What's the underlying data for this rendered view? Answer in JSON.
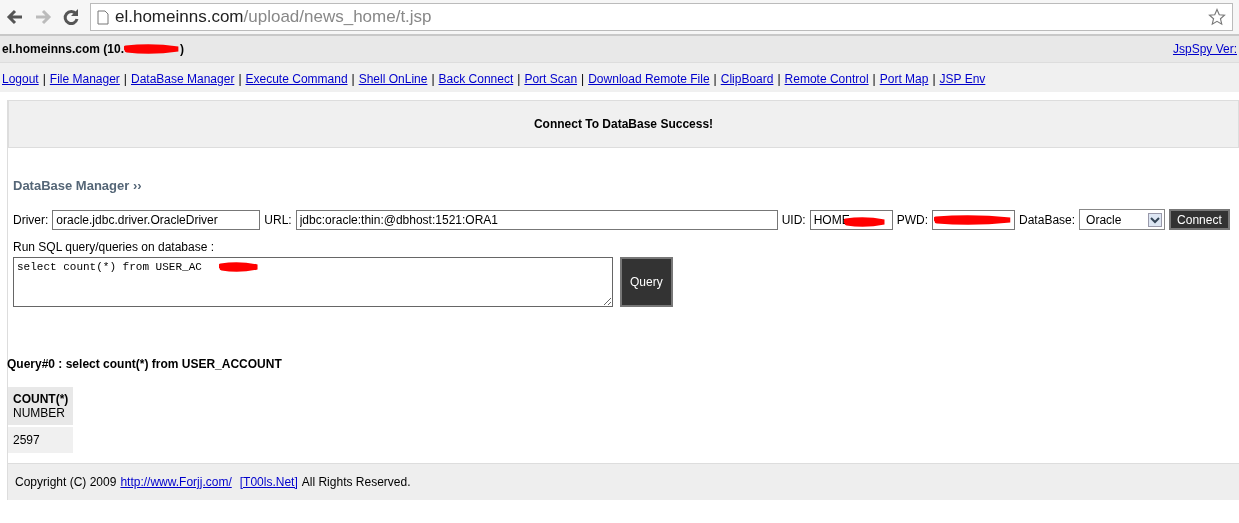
{
  "browser": {
    "url_host": "el.homeinns.com",
    "url_path": "/upload/news_home/t.jsp"
  },
  "header": {
    "host_prefix": "el.homeinns.com (10.",
    "host_suffix": ")",
    "redacted": true,
    "version_link": "JspSpy Ver:"
  },
  "nav": [
    "Logout",
    "File Manager",
    "DataBase Manager",
    "Execute Command",
    "Shell OnLine",
    "Back Connect",
    "Port Scan",
    "Download Remote File",
    "ClipBoard",
    "Remote Control",
    "Port Map",
    "JSP Env"
  ],
  "nav_separator": "|",
  "message": "Connect To DataBase Success!",
  "section_title": "DataBase Manager ››",
  "form": {
    "driver_label": "Driver:",
    "driver": "oracle.jdbc.driver.OracleDriver",
    "url_label": "URL:",
    "url": "jdbc:oracle:thin:@dbhost:1521:ORA1",
    "uid_label": "UID:",
    "uid": "HOME",
    "pwd_label": "PWD:",
    "database_label": "DataBase:",
    "database": "Oracle",
    "connect": "Connect"
  },
  "sql": {
    "label": "Run SQL query/queries on database :",
    "value": "select count(*) from USER_AC",
    "query_button": "Query"
  },
  "result": {
    "title": "Query#0 : select count(*) from USER_ACCOUNT",
    "columns": [
      {
        "name": "COUNT(*)",
        "type": "NUMBER"
      }
    ],
    "rows": [
      [
        "2597"
      ]
    ]
  },
  "footer": {
    "prefix": "Copyright (C) 2009",
    "link1": "http://www.Forjj.com/",
    "link2": "[T00ls.Net]",
    "suffix": "All Rights Reserved."
  }
}
